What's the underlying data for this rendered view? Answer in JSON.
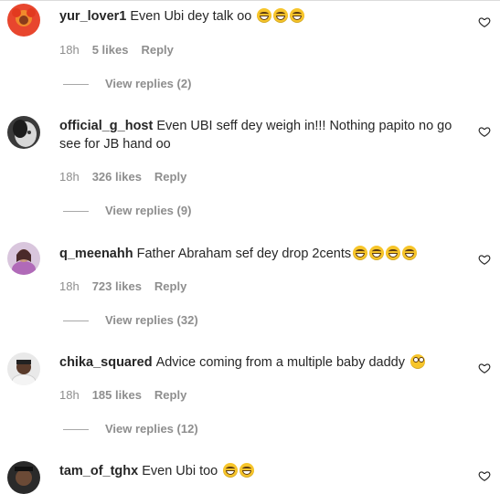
{
  "comments": [
    {
      "username": "yur_lover1",
      "text": "Even Ubi dey talk oo",
      "emojis": [
        "laugh-emoji",
        "laugh-emoji",
        "laugh-emoji"
      ],
      "time": "18h",
      "likes": "5 likes",
      "reply": "Reply",
      "view_replies": "View replies (2)"
    },
    {
      "username": "official_g_host",
      "text": "Even UBI seff dey weigh in!!! Nothing papito no go see for JB hand oo",
      "emojis": [],
      "time": "18h",
      "likes": "326 likes",
      "reply": "Reply",
      "view_replies": "View replies (9)"
    },
    {
      "username": "q_meenahh",
      "text": "Father Abraham sef dey drop 2cents",
      "emojis": [
        "laugh-emoji",
        "laugh-emoji",
        "laugh-emoji",
        "laugh-emoji"
      ],
      "time": "18h",
      "likes": "723 likes",
      "reply": "Reply",
      "view_replies": "View replies (32)"
    },
    {
      "username": "chika_squared",
      "text": "Advice coming from a multiple baby daddy",
      "emojis": [
        "eye-roll-emoji"
      ],
      "time": "18h",
      "likes": "185 likes",
      "reply": "Reply",
      "view_replies": "View replies (12)"
    },
    {
      "username": "tam_of_tghx",
      "text": "Even Ubi too",
      "emojis": [
        "laugh-emoji",
        "laugh-emoji"
      ]
    }
  ],
  "icons": {
    "like": "heart-outline-icon"
  },
  "colors": {
    "username": "#262626",
    "meta": "#8e8e8e",
    "divider": "#dbdbdb"
  }
}
